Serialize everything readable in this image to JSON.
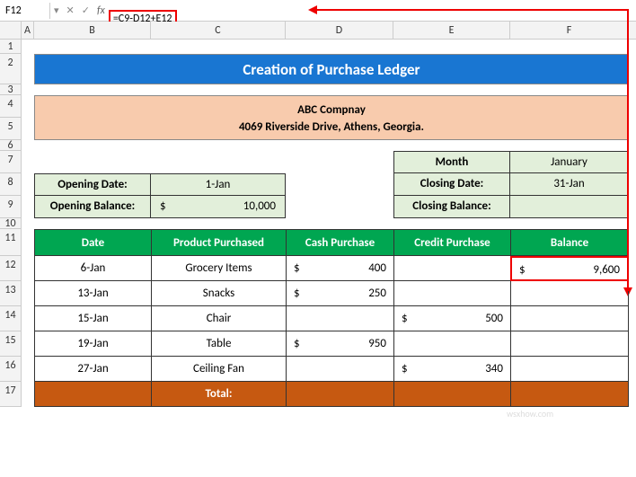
{
  "nameBox": "F12",
  "formula": "=C9-D12+E12",
  "columns": [
    "A",
    "B",
    "C",
    "D",
    "E",
    "F"
  ],
  "rows": [
    "1",
    "2",
    "3",
    "4",
    "5",
    "6",
    "7",
    "8",
    "9",
    "10",
    "11",
    "12",
    "13",
    "14",
    "15",
    "16",
    "17"
  ],
  "title": "Creation of Purchase Ledger",
  "company": {
    "name": "ABC Compnay",
    "address": "4069 Riverside Drive, Athens, Georgia."
  },
  "opening": {
    "dateLabel": "Opening Date:",
    "dateValue": "1-Jan",
    "balanceLabel": "Opening Balance:",
    "balanceCurrency": "$",
    "balanceValue": "10,000"
  },
  "monthSection": {
    "monthLabel": "Month",
    "monthValue": "January",
    "closingDateLabel": "Closing Date:",
    "closingDateValue": "31-Jan",
    "closingBalanceLabel": "Closing Balance:",
    "closingBalanceValue": ""
  },
  "tableHeaders": {
    "date": "Date",
    "product": "Product Purchased",
    "cash": "Cash Purchase",
    "credit": "Credit Purchase",
    "balance": "Balance"
  },
  "tableRows": [
    {
      "date": "6-Jan",
      "product": "Grocery Items",
      "cashSym": "$",
      "cash": "400",
      "creditSym": "",
      "credit": "",
      "balSym": "$",
      "balance": "9,600"
    },
    {
      "date": "13-Jan",
      "product": "Snacks",
      "cashSym": "$",
      "cash": "250",
      "creditSym": "",
      "credit": "",
      "balSym": "",
      "balance": ""
    },
    {
      "date": "15-Jan",
      "product": "Chair",
      "cashSym": "",
      "cash": "",
      "creditSym": "$",
      "credit": "500",
      "balSym": "",
      "balance": ""
    },
    {
      "date": "19-Jan",
      "product": "Table",
      "cashSym": "$",
      "cash": "950",
      "creditSym": "",
      "credit": "",
      "balSym": "",
      "balance": ""
    },
    {
      "date": "27-Jan",
      "product": "Ceiling Fan",
      "cashSym": "",
      "cash": "",
      "creditSym": "$",
      "credit": "340",
      "balSym": "",
      "balance": ""
    }
  ],
  "totalLabel": "Total:",
  "watermark": "wsxhow.com"
}
